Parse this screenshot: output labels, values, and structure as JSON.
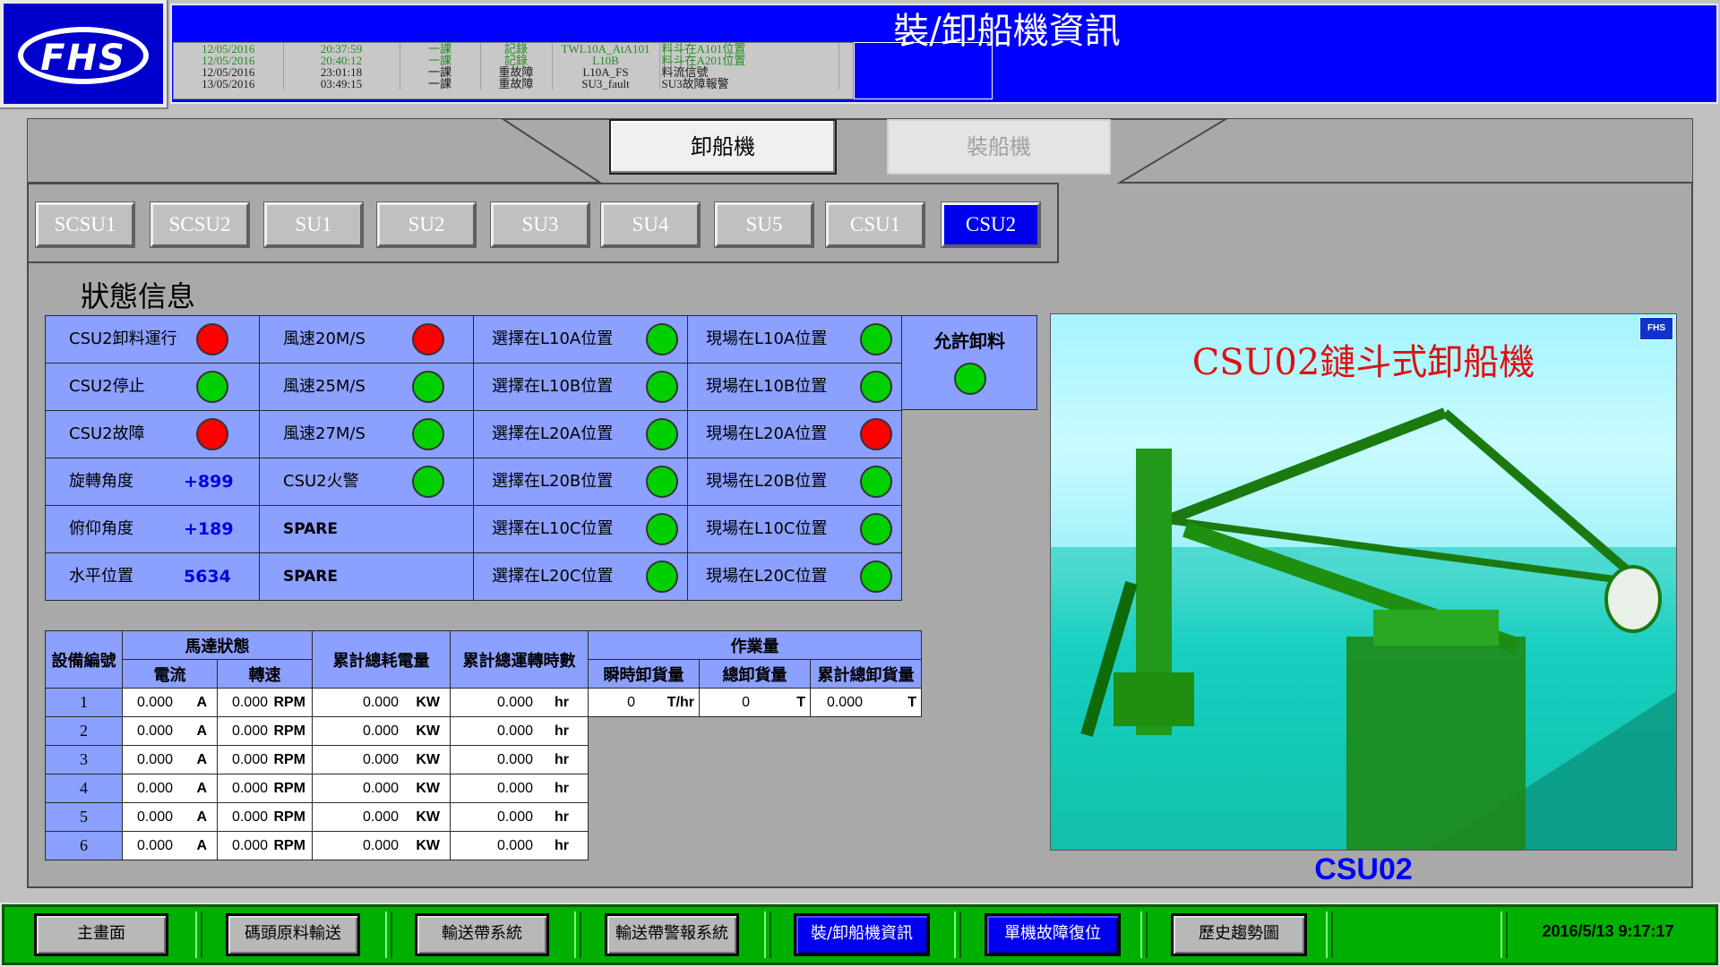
{
  "header": {
    "logo_text": "FHS",
    "title": "裝/卸船機資訊",
    "event_log": [
      {
        "date": "12/05/2016",
        "time": "20:37:59",
        "level": "一課",
        "type": "記錄",
        "tag": "TWL10A_AtA101",
        "message": "料斗在A101位置"
      },
      {
        "date": "12/05/2016",
        "time": "20:40:12",
        "level": "一課",
        "type": "記錄",
        "tag": "L10B",
        "message": "料斗在A201位置"
      },
      {
        "date": "12/05/2016",
        "time": "23:01:18",
        "level": "一課",
        "type": "重故障",
        "tag": "L10A_FS",
        "message": "料流信號"
      },
      {
        "date": "13/05/2016",
        "time": "03:49:15",
        "level": "一課",
        "type": "重故障",
        "tag": "SU3_fault",
        "message": "SU3故障報警"
      }
    ]
  },
  "mode_tabs": {
    "unload": "卸船機",
    "load": "裝船機"
  },
  "units": [
    "SCSU1",
    "SCSU2",
    "SU1",
    "SU2",
    "SU3",
    "SU4",
    "SU5",
    "CSU1",
    "CSU2"
  ],
  "active_unit": "CSU2",
  "status": {
    "title": "狀態信息",
    "col1": [
      {
        "label": "CSU2卸料運行",
        "lamp": "red"
      },
      {
        "label": "CSU2停止",
        "lamp": "green"
      },
      {
        "label": "CSU2故障",
        "lamp": "red"
      },
      {
        "label": "旋轉角度",
        "value": "+899"
      },
      {
        "label": "俯仰角度",
        "value": "+189"
      },
      {
        "label": "水平位置",
        "value": "5634"
      }
    ],
    "col2": [
      {
        "label": "風速20M/S",
        "lamp": "red"
      },
      {
        "label": "風速25M/S",
        "lamp": "green"
      },
      {
        "label": "風速27M/S",
        "lamp": "green"
      },
      {
        "label": "CSU2火警",
        "lamp": "green"
      },
      {
        "label": "SPARE"
      },
      {
        "label": "SPARE"
      }
    ],
    "col3": [
      {
        "label": "選擇在L10A位置",
        "lamp": "green"
      },
      {
        "label": "選擇在L10B位置",
        "lamp": "green"
      },
      {
        "label": "選擇在L20A位置",
        "lamp": "green"
      },
      {
        "label": "選擇在L20B位置",
        "lamp": "green"
      },
      {
        "label": "選擇在L10C位置",
        "lamp": "green"
      },
      {
        "label": "選擇在L20C位置",
        "lamp": "green"
      }
    ],
    "col4": [
      {
        "label": "現場在L10A位置",
        "lamp": "green"
      },
      {
        "label": "現場在L10B位置",
        "lamp": "green"
      },
      {
        "label": "現場在L20A位置",
        "lamp": "red"
      },
      {
        "label": "現場在L20B位置",
        "lamp": "green"
      },
      {
        "label": "現場在L10C位置",
        "lamp": "green"
      },
      {
        "label": "現場在L20C位置",
        "lamp": "green"
      }
    ],
    "permit": {
      "label": "允許卸料",
      "lamp": "green"
    }
  },
  "machine_table": {
    "headers": {
      "device_no": "設備編號",
      "motor_status": "馬達狀態",
      "current": "電流",
      "speed": "轉速",
      "energy": "累計總耗電量",
      "runtime": "累計總運轉時數",
      "workload": "作業量",
      "instant": "瞬時卸貨量",
      "total": "總卸貨量",
      "cumulative": "累計總卸貨量"
    },
    "rows": [
      {
        "no": "1",
        "current": "0.000",
        "current_unit": "A",
        "speed": "0.000",
        "speed_unit": "RPM",
        "energy": "0.000",
        "energy_unit": "KW",
        "runtime": "0.000",
        "runtime_unit": "hr"
      },
      {
        "no": "2",
        "current": "0.000",
        "current_unit": "A",
        "speed": "0.000",
        "speed_unit": "RPM",
        "energy": "0.000",
        "energy_unit": "KW",
        "runtime": "0.000",
        "runtime_unit": "hr"
      },
      {
        "no": "3",
        "current": "0.000",
        "current_unit": "A",
        "speed": "0.000",
        "speed_unit": "RPM",
        "energy": "0.000",
        "energy_unit": "KW",
        "runtime": "0.000",
        "runtime_unit": "hr"
      },
      {
        "no": "4",
        "current": "0.000",
        "current_unit": "A",
        "speed": "0.000",
        "speed_unit": "RPM",
        "energy": "0.000",
        "energy_unit": "KW",
        "runtime": "0.000",
        "runtime_unit": "hr"
      },
      {
        "no": "5",
        "current": "0.000",
        "current_unit": "A",
        "speed": "0.000",
        "speed_unit": "RPM",
        "energy": "0.000",
        "energy_unit": "KW",
        "runtime": "0.000",
        "runtime_unit": "hr"
      },
      {
        "no": "6",
        "current": "0.000",
        "current_unit": "A",
        "speed": "0.000",
        "speed_unit": "RPM",
        "energy": "0.000",
        "energy_unit": "KW",
        "runtime": "0.000",
        "runtime_unit": "hr"
      }
    ],
    "workload_values": {
      "instant": "0",
      "instant_unit": "T/hr",
      "total": "0",
      "total_unit": "T",
      "cumulative": "0.000",
      "cumulative_unit": "T"
    }
  },
  "photo": {
    "title": "CSU02鏈斗式卸船機",
    "logo": "FHS",
    "caption": "CSU02"
  },
  "footer": {
    "nav": [
      "主畫面",
      "碼頭原料輸送",
      "輸送帶系統",
      "輸送帶警報系統",
      "裝/卸船機資訊",
      "單機故障復位",
      "歷史趨勢圖"
    ],
    "clock": "2016/5/13 9:17:17"
  },
  "colors": {
    "header_blue": "#0000ff",
    "cell_blue": "#8ca0ff",
    "footer_green": "#00b000",
    "lamp_red": "#ff0000",
    "lamp_green": "#00d000",
    "value_blue": "#0000e0"
  }
}
